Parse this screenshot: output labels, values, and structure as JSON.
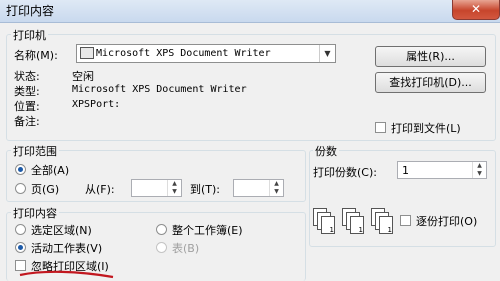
{
  "window": {
    "title": "打印内容",
    "close_symbol": "✕"
  },
  "printer": {
    "group_label": "打印机",
    "name_label": "名称(M):",
    "name_value": "Microsoft XPS Document Writer",
    "status_label": "状态:",
    "status_value": "空闲",
    "type_label": "类型:",
    "type_value": "Microsoft XPS Document Writer",
    "where_label": "位置:",
    "where_value": "XPSPort:",
    "comment_label": "备注:",
    "properties_button": "属性(R)...",
    "find_button": "查找打印机(D)...",
    "print_to_file": "打印到文件(L)"
  },
  "range": {
    "group_label": "打印范围",
    "all": "全部(A)",
    "pages": "页(G)",
    "from_label": "从(F):",
    "to_label": "到(T):",
    "from_value": "",
    "to_value": ""
  },
  "what": {
    "group_label": "打印内容",
    "selection": "选定区域(N)",
    "active_sheets": "活动工作表(V)",
    "ignore_area": "忽略打印区域(I)",
    "workbook": "整个工作簿(E)",
    "table": "表(B)"
  },
  "copies": {
    "group_label": "份数",
    "count_label": "打印份数(C):",
    "count_value": "1",
    "collate_label": "逐份打印(O)"
  }
}
